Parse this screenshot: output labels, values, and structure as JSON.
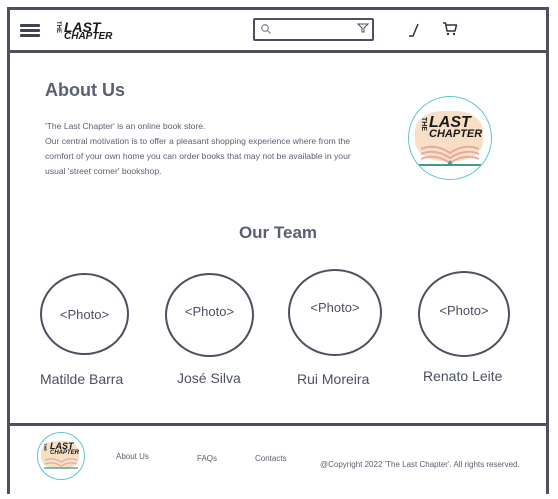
{
  "header": {
    "logo": {
      "the": "THE",
      "last": "LAST",
      "chapter": "CHAPTER"
    },
    "search_placeholder": ""
  },
  "about": {
    "title": "About Us",
    "lines": [
      "'The Last Chapter' is an online book store.",
      "Our central motivation is to offer a pleasant shopping experience where from the",
      "comfort of your own home you can order books that may not be available in your",
      "usual 'street corner' bookshop."
    ]
  },
  "team": {
    "title": "Our Team",
    "members": [
      {
        "photo": "<Photo>",
        "name": "Matilde Barra"
      },
      {
        "photo": "<Photo>",
        "name": "José Silva"
      },
      {
        "photo": "<Photo>",
        "name": "Rui Moreira"
      },
      {
        "photo": "<Photo>",
        "name": "Renato Leite"
      }
    ]
  },
  "footer": {
    "links": [
      "About Us",
      "FAQs",
      "Contacts"
    ],
    "copyright": "@Copyright 2022 'The Last Chapter'. All rights reserved."
  },
  "colors": {
    "border": "#4c5060",
    "text": "#5a6072",
    "logo_ring": "#5cc7d0",
    "logo_bg": "#f6dfc4"
  }
}
